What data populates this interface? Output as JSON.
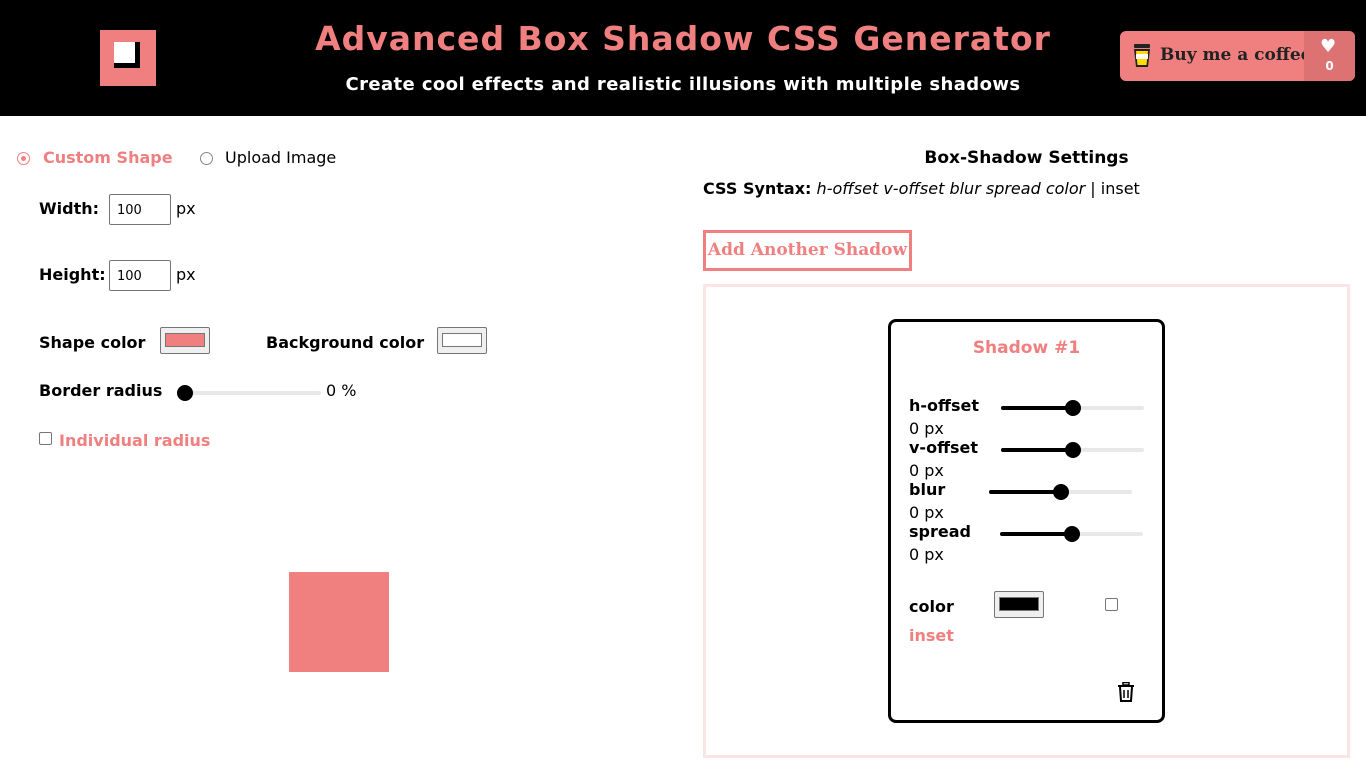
{
  "header": {
    "title": "Advanced Box Shadow CSS Generator",
    "subtitle": "Create cool effects and realistic illusions with multiple shadows",
    "coffee_label": "Buy me a coffee",
    "like_count": "0",
    "icons": [
      "logo-icon",
      "coffee-cup-icon",
      "heart-icon"
    ]
  },
  "shape_panel": {
    "mode_custom": "Custom Shape",
    "mode_upload": "Upload Image",
    "width_label": "Width:",
    "width_value": "100",
    "height_label": "Height:",
    "height_value": "100",
    "unit_px": "px",
    "shape_color_label": "Shape color",
    "shape_color": "#f08080",
    "background_color_label": "Background color",
    "background_color": "#ffffff",
    "border_radius_label": "Border radius",
    "border_radius_value": "0 %",
    "border_radius_level": 0,
    "individual_radius_label": "Individual radius"
  },
  "settings": {
    "heading": "Box-Shadow Settings",
    "syntax_label": "CSS Syntax:",
    "syntax_params": "h-offset v-offset blur spread color",
    "syntax_inset": " | inset",
    "add_button": "Add Another Shadow"
  },
  "shadow_card": {
    "title": "Shadow #1",
    "sliders": [
      {
        "label": "h-offset",
        "value": "0 px",
        "level": 0.5
      },
      {
        "label": "v-offset",
        "value": "0 px",
        "level": 0.5
      },
      {
        "label": "blur",
        "value": "0 px",
        "level": 0.5
      },
      {
        "label": "spread",
        "value": "0 px",
        "level": 0.5
      }
    ],
    "color_label": "color",
    "color_value": "#000000",
    "inset_label": "inset",
    "delete_icon": "trash-icon"
  },
  "colors": {
    "accent": "#f08080",
    "header_bg": "#000000",
    "panel_border": "#fde4e4"
  }
}
